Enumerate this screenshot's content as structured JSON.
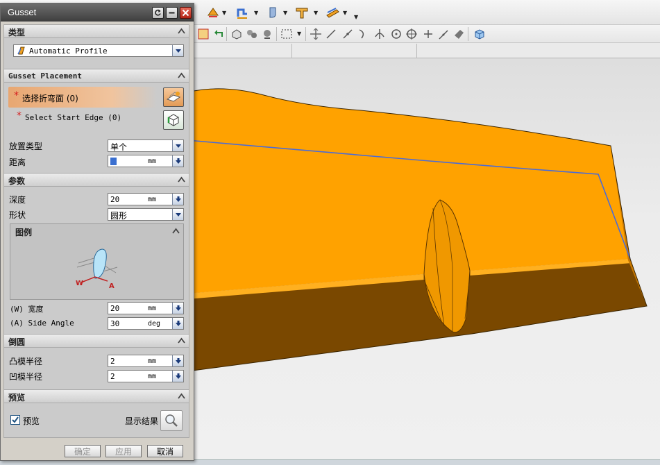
{
  "dialog": {
    "title": "Gusset"
  },
  "sections": {
    "type": {
      "header": "类型",
      "method_value": "Automatic Profile"
    },
    "placement": {
      "header": "Gusset Placement",
      "select_bend_face": "选择折弯面 (0)",
      "select_start_edge": "Select Start Edge (0)",
      "required_marker": "*",
      "placement_type_label": "放置类型",
      "placement_type_value": "单个",
      "distance_label": "距离",
      "distance_unit": "mm"
    },
    "parameters": {
      "header": "参数",
      "depth_label": "深度",
      "depth_value": "20",
      "depth_unit": "mm",
      "shape_label": "形状",
      "shape_value": "圆形",
      "legend_header": "图例",
      "legend_w": "W",
      "legend_a": "A",
      "width_label": "(W) 宽度",
      "width_value": "20",
      "width_unit": "mm",
      "side_angle_label": "(A) Side Angle",
      "side_angle_value": "30",
      "side_angle_unit": "deg"
    },
    "rounding": {
      "header": "倒圆",
      "punch_radius_label": "凸模半径",
      "punch_radius_value": "2",
      "punch_radius_unit": "mm",
      "die_radius_label": "凹模半径",
      "die_radius_value": "2",
      "die_radius_unit": "mm"
    },
    "preview": {
      "header": "预览",
      "preview_label": "预览",
      "preview_checked": true,
      "show_result_label": "显示结果"
    }
  },
  "buttons": {
    "ok": "确定",
    "apply": "应用",
    "cancel": "取消"
  },
  "icons": {
    "section_toggle": "collapse-caret-up-icon",
    "method": "profile-icon",
    "bend_face": "face-selector-icon",
    "start_edge": "edge-selector-icon",
    "show_result": "magnifier-icon"
  },
  "colors": {
    "part_top": "#ffa200",
    "part_side": "#7a4a00",
    "edge_curve": "#4a6bd8",
    "selection_highlight": "#e8a772"
  }
}
